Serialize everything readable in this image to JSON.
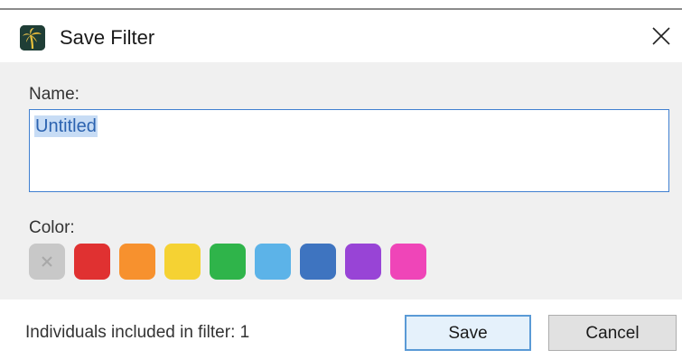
{
  "window": {
    "title": "Save Filter",
    "app_icon": "palm-tree-icon",
    "close_icon": "close-icon"
  },
  "name_field": {
    "label": "Name:",
    "value": "Untitled"
  },
  "color_picker": {
    "label": "Color:",
    "swatches": [
      {
        "name": "none",
        "hex": "#c8c8c8",
        "icon": "close-icon"
      },
      {
        "name": "red",
        "hex": "#e03131"
      },
      {
        "name": "orange",
        "hex": "#f7912e"
      },
      {
        "name": "yellow",
        "hex": "#f5d233"
      },
      {
        "name": "green",
        "hex": "#2fb44a"
      },
      {
        "name": "light-blue",
        "hex": "#5cb3e8"
      },
      {
        "name": "blue",
        "hex": "#3e74c0"
      },
      {
        "name": "purple",
        "hex": "#9844d6"
      },
      {
        "name": "pink",
        "hex": "#ef45b8"
      }
    ]
  },
  "footer": {
    "status": "Individuals included in filter: 1",
    "save_label": "Save",
    "cancel_label": "Cancel"
  }
}
